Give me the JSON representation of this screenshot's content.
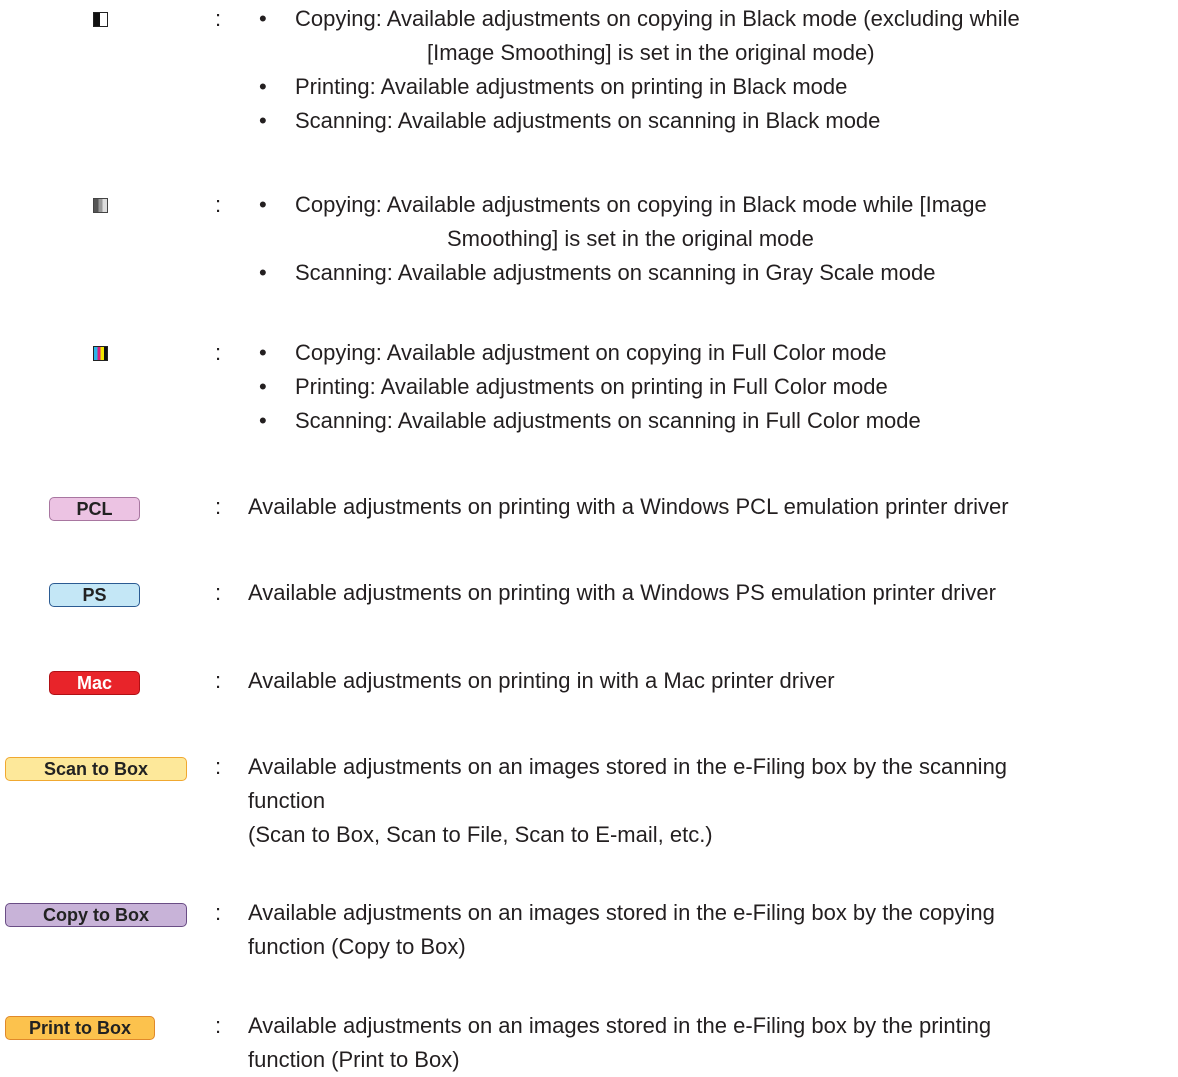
{
  "colon": ":",
  "bullet": "•",
  "mode_black": {
    "icon": "black-mode-icon",
    "lines": [
      {
        "bullet": true,
        "text": "Copying: Available adjustments on copying in Black mode (excluding while"
      },
      {
        "bullet": false,
        "text": "[Image Smoothing] is set in the original mode)"
      },
      {
        "bullet": true,
        "text": "Printing: Available adjustments on printing in Black mode"
      },
      {
        "bullet": true,
        "text": "Scanning: Available adjustments on scanning in Black mode"
      }
    ]
  },
  "mode_gray": {
    "icon": "gray-scale-mode-icon",
    "lines": [
      {
        "bullet": true,
        "text": "Copying: Available adjustments on copying in Black mode while [Image"
      },
      {
        "bullet": false,
        "text": "Smoothing] is set in the original mode"
      },
      {
        "bullet": true,
        "text": "Scanning: Available adjustments on scanning in Gray Scale mode"
      }
    ]
  },
  "mode_color": {
    "icon": "full-color-mode-icon",
    "lines": [
      {
        "bullet": true,
        "text": "Copying: Available adjustment on copying in Full Color mode"
      },
      {
        "bullet": true,
        "text": "Printing: Available adjustments on printing in Full Color mode"
      },
      {
        "bullet": true,
        "text": "Scanning: Available adjustments on scanning in Full Color mode"
      }
    ]
  },
  "pcl": {
    "badge": "PCL",
    "color": "#ecc3e3",
    "text": "Available adjustments on printing with a Windows PCL emulation printer driver"
  },
  "ps": {
    "badge": "PS",
    "color": "#c4e7f6",
    "text": "Available adjustments on printing with a Windows PS emulation printer driver"
  },
  "mac": {
    "badge": "Mac",
    "color": "#e8242a",
    "text": "Available adjustments on printing in with a Mac printer driver"
  },
  "scan_to_box": {
    "badge": "Scan to Box",
    "color": "#fde89a",
    "lines": [
      "Available adjustments on an images stored in the e-Filing box by the scanning",
      "function",
      "(Scan to Box, Scan to File, Scan to E-mail, etc.)"
    ]
  },
  "copy_to_box": {
    "badge": "Copy to Box",
    "color": "#c8b3d8",
    "lines": [
      "Available adjustments on an images stored in the e-Filing box by the copying",
      "function (Copy to Box)"
    ]
  },
  "print_to_box": {
    "badge": "Print to Box",
    "color": "#fcc24d",
    "lines": [
      "Available adjustments on an images stored in the e-Filing box by the printing",
      "function (Print to Box)"
    ]
  }
}
